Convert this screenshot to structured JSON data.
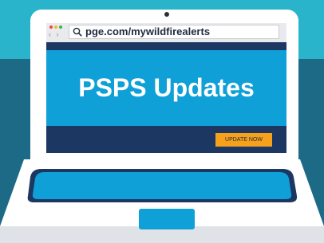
{
  "browser": {
    "url": "pge.com/mywildfirealerts",
    "nav_arrows": "‹ ›",
    "window_controls": [
      "close",
      "minimize",
      "maximize"
    ]
  },
  "page": {
    "title": "PSPS Updates",
    "cta_label": "UPDATE NOW"
  },
  "colors": {
    "background_top": "#29b4cc",
    "background_bottom": "#1d6a87",
    "hero": "#0fa0d8",
    "navy": "#1d3763",
    "cta": "#f5a11c",
    "trackpad": "#0fa0d8"
  },
  "icons": {
    "search": "search-icon",
    "camera": "camera-icon"
  }
}
